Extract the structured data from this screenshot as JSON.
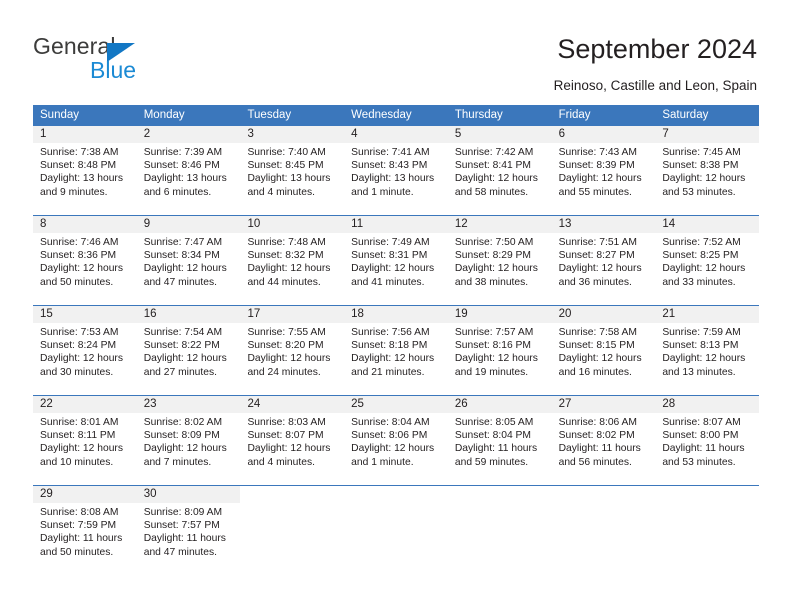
{
  "brand": {
    "name_top": "General",
    "name_bottom": "Blue"
  },
  "header": {
    "title": "September 2024",
    "location": "Reinoso, Castille and Leon, Spain"
  },
  "colors": {
    "header_blue": "#3b77bc",
    "daynum_gray": "#f1f1f1",
    "brand_blue": "#1b8ad4",
    "text": "#231f20"
  },
  "weekdays": [
    "Sunday",
    "Monday",
    "Tuesday",
    "Wednesday",
    "Thursday",
    "Friday",
    "Saturday"
  ],
  "weeks": [
    [
      {
        "day": "1",
        "sunrise": "Sunrise: 7:38 AM",
        "sunset": "Sunset: 8:48 PM",
        "daylight1": "Daylight: 13 hours",
        "daylight2": "and 9 minutes."
      },
      {
        "day": "2",
        "sunrise": "Sunrise: 7:39 AM",
        "sunset": "Sunset: 8:46 PM",
        "daylight1": "Daylight: 13 hours",
        "daylight2": "and 6 minutes."
      },
      {
        "day": "3",
        "sunrise": "Sunrise: 7:40 AM",
        "sunset": "Sunset: 8:45 PM",
        "daylight1": "Daylight: 13 hours",
        "daylight2": "and 4 minutes."
      },
      {
        "day": "4",
        "sunrise": "Sunrise: 7:41 AM",
        "sunset": "Sunset: 8:43 PM",
        "daylight1": "Daylight: 13 hours",
        "daylight2": "and 1 minute."
      },
      {
        "day": "5",
        "sunrise": "Sunrise: 7:42 AM",
        "sunset": "Sunset: 8:41 PM",
        "daylight1": "Daylight: 12 hours",
        "daylight2": "and 58 minutes."
      },
      {
        "day": "6",
        "sunrise": "Sunrise: 7:43 AM",
        "sunset": "Sunset: 8:39 PM",
        "daylight1": "Daylight: 12 hours",
        "daylight2": "and 55 minutes."
      },
      {
        "day": "7",
        "sunrise": "Sunrise: 7:45 AM",
        "sunset": "Sunset: 8:38 PM",
        "daylight1": "Daylight: 12 hours",
        "daylight2": "and 53 minutes."
      }
    ],
    [
      {
        "day": "8",
        "sunrise": "Sunrise: 7:46 AM",
        "sunset": "Sunset: 8:36 PM",
        "daylight1": "Daylight: 12 hours",
        "daylight2": "and 50 minutes."
      },
      {
        "day": "9",
        "sunrise": "Sunrise: 7:47 AM",
        "sunset": "Sunset: 8:34 PM",
        "daylight1": "Daylight: 12 hours",
        "daylight2": "and 47 minutes."
      },
      {
        "day": "10",
        "sunrise": "Sunrise: 7:48 AM",
        "sunset": "Sunset: 8:32 PM",
        "daylight1": "Daylight: 12 hours",
        "daylight2": "and 44 minutes."
      },
      {
        "day": "11",
        "sunrise": "Sunrise: 7:49 AM",
        "sunset": "Sunset: 8:31 PM",
        "daylight1": "Daylight: 12 hours",
        "daylight2": "and 41 minutes."
      },
      {
        "day": "12",
        "sunrise": "Sunrise: 7:50 AM",
        "sunset": "Sunset: 8:29 PM",
        "daylight1": "Daylight: 12 hours",
        "daylight2": "and 38 minutes."
      },
      {
        "day": "13",
        "sunrise": "Sunrise: 7:51 AM",
        "sunset": "Sunset: 8:27 PM",
        "daylight1": "Daylight: 12 hours",
        "daylight2": "and 36 minutes."
      },
      {
        "day": "14",
        "sunrise": "Sunrise: 7:52 AM",
        "sunset": "Sunset: 8:25 PM",
        "daylight1": "Daylight: 12 hours",
        "daylight2": "and 33 minutes."
      }
    ],
    [
      {
        "day": "15",
        "sunrise": "Sunrise: 7:53 AM",
        "sunset": "Sunset: 8:24 PM",
        "daylight1": "Daylight: 12 hours",
        "daylight2": "and 30 minutes."
      },
      {
        "day": "16",
        "sunrise": "Sunrise: 7:54 AM",
        "sunset": "Sunset: 8:22 PM",
        "daylight1": "Daylight: 12 hours",
        "daylight2": "and 27 minutes."
      },
      {
        "day": "17",
        "sunrise": "Sunrise: 7:55 AM",
        "sunset": "Sunset: 8:20 PM",
        "daylight1": "Daylight: 12 hours",
        "daylight2": "and 24 minutes."
      },
      {
        "day": "18",
        "sunrise": "Sunrise: 7:56 AM",
        "sunset": "Sunset: 8:18 PM",
        "daylight1": "Daylight: 12 hours",
        "daylight2": "and 21 minutes."
      },
      {
        "day": "19",
        "sunrise": "Sunrise: 7:57 AM",
        "sunset": "Sunset: 8:16 PM",
        "daylight1": "Daylight: 12 hours",
        "daylight2": "and 19 minutes."
      },
      {
        "day": "20",
        "sunrise": "Sunrise: 7:58 AM",
        "sunset": "Sunset: 8:15 PM",
        "daylight1": "Daylight: 12 hours",
        "daylight2": "and 16 minutes."
      },
      {
        "day": "21",
        "sunrise": "Sunrise: 7:59 AM",
        "sunset": "Sunset: 8:13 PM",
        "daylight1": "Daylight: 12 hours",
        "daylight2": "and 13 minutes."
      }
    ],
    [
      {
        "day": "22",
        "sunrise": "Sunrise: 8:01 AM",
        "sunset": "Sunset: 8:11 PM",
        "daylight1": "Daylight: 12 hours",
        "daylight2": "and 10 minutes."
      },
      {
        "day": "23",
        "sunrise": "Sunrise: 8:02 AM",
        "sunset": "Sunset: 8:09 PM",
        "daylight1": "Daylight: 12 hours",
        "daylight2": "and 7 minutes."
      },
      {
        "day": "24",
        "sunrise": "Sunrise: 8:03 AM",
        "sunset": "Sunset: 8:07 PM",
        "daylight1": "Daylight: 12 hours",
        "daylight2": "and 4 minutes."
      },
      {
        "day": "25",
        "sunrise": "Sunrise: 8:04 AM",
        "sunset": "Sunset: 8:06 PM",
        "daylight1": "Daylight: 12 hours",
        "daylight2": "and 1 minute."
      },
      {
        "day": "26",
        "sunrise": "Sunrise: 8:05 AM",
        "sunset": "Sunset: 8:04 PM",
        "daylight1": "Daylight: 11 hours",
        "daylight2": "and 59 minutes."
      },
      {
        "day": "27",
        "sunrise": "Sunrise: 8:06 AM",
        "sunset": "Sunset: 8:02 PM",
        "daylight1": "Daylight: 11 hours",
        "daylight2": "and 56 minutes."
      },
      {
        "day": "28",
        "sunrise": "Sunrise: 8:07 AM",
        "sunset": "Sunset: 8:00 PM",
        "daylight1": "Daylight: 11 hours",
        "daylight2": "and 53 minutes."
      }
    ],
    [
      {
        "day": "29",
        "sunrise": "Sunrise: 8:08 AM",
        "sunset": "Sunset: 7:59 PM",
        "daylight1": "Daylight: 11 hours",
        "daylight2": "and 50 minutes."
      },
      {
        "day": "30",
        "sunrise": "Sunrise: 8:09 AM",
        "sunset": "Sunset: 7:57 PM",
        "daylight1": "Daylight: 11 hours",
        "daylight2": "and 47 minutes."
      },
      {
        "day": "",
        "sunrise": "",
        "sunset": "",
        "daylight1": "",
        "daylight2": ""
      },
      {
        "day": "",
        "sunrise": "",
        "sunset": "",
        "daylight1": "",
        "daylight2": ""
      },
      {
        "day": "",
        "sunrise": "",
        "sunset": "",
        "daylight1": "",
        "daylight2": ""
      },
      {
        "day": "",
        "sunrise": "",
        "sunset": "",
        "daylight1": "",
        "daylight2": ""
      },
      {
        "day": "",
        "sunrise": "",
        "sunset": "",
        "daylight1": "",
        "daylight2": ""
      }
    ]
  ]
}
